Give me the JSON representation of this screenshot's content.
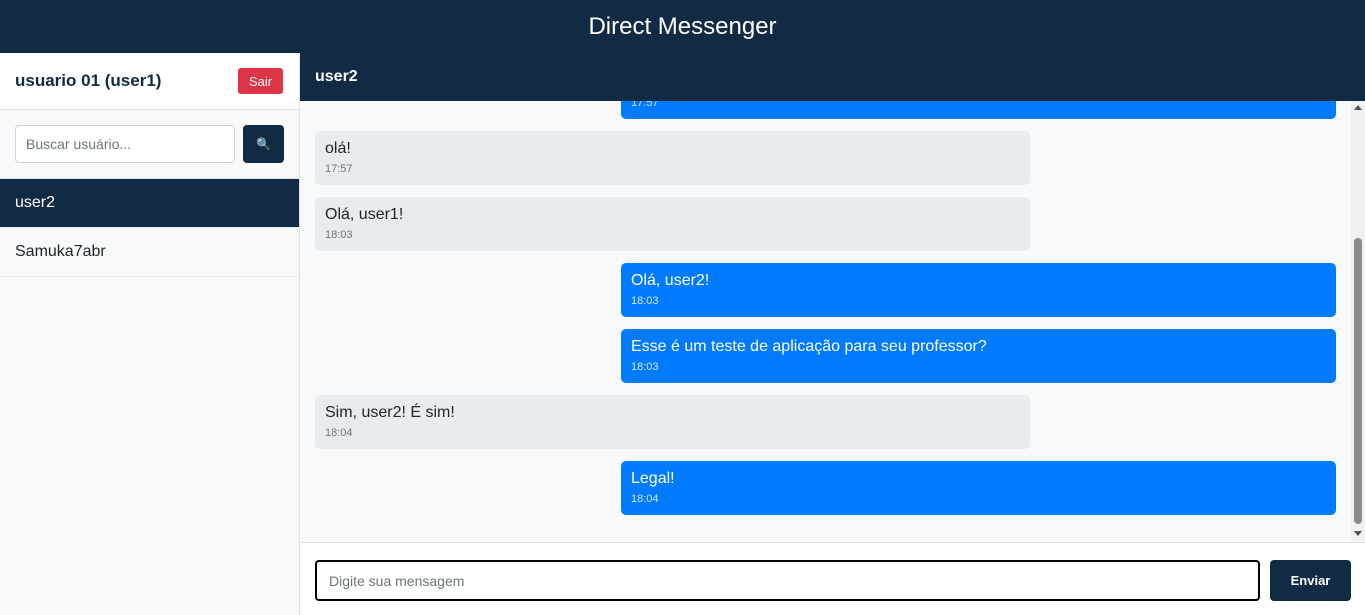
{
  "app": {
    "title": "Direct Messenger"
  },
  "sidebar": {
    "current_user": "usuario 01 (user1)",
    "logout_label": "Sair",
    "search_placeholder": "Buscar usuário...",
    "search_icon": "🔍",
    "contacts": [
      {
        "name": "user2",
        "active": true
      },
      {
        "name": "Samuka7abr",
        "active": false
      }
    ]
  },
  "chat": {
    "contact_name": "user2",
    "messages": [
      {
        "direction": "out",
        "text": "",
        "time": "17:57"
      },
      {
        "direction": "in",
        "text": "olá!",
        "time": "17:57"
      },
      {
        "direction": "in",
        "text": "Olá, user1!",
        "time": "18:03"
      },
      {
        "direction": "out",
        "text": "Olá, user2!",
        "time": "18:03"
      },
      {
        "direction": "out",
        "text": "Esse é um teste de aplicação para seu professor?",
        "time": "18:03"
      },
      {
        "direction": "in",
        "text": "Sim, user2! É sim!",
        "time": "18:04"
      },
      {
        "direction": "out",
        "text": "Legal!",
        "time": "18:04"
      }
    ],
    "input_placeholder": "Digite sua mensagem",
    "send_label": "Enviar"
  },
  "colors": {
    "navy": "#112b45",
    "outgoing": "#007bff",
    "incoming": "#e9ecef",
    "logout": "#dc3545"
  }
}
